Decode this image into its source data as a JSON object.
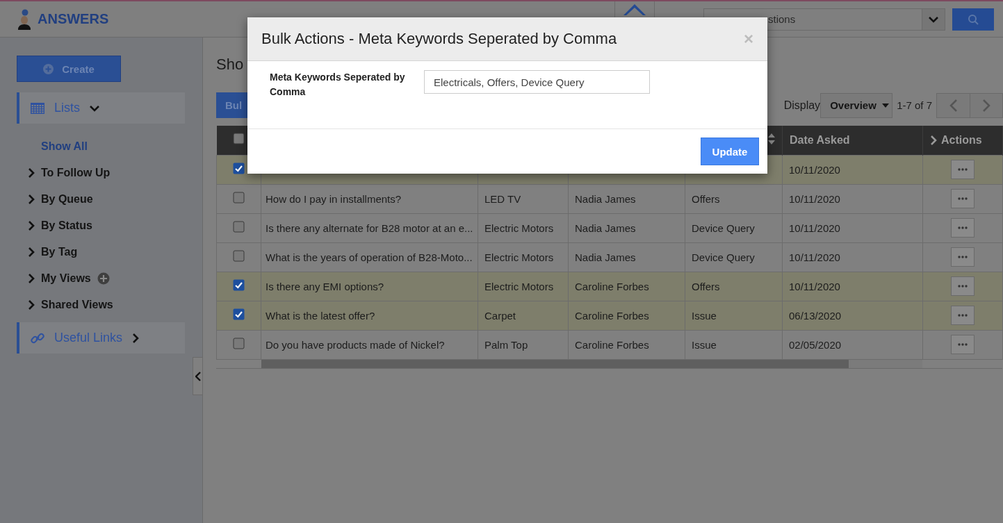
{
  "header": {
    "logo": "ANSWERS",
    "search": {
      "placeholder": "stions"
    }
  },
  "sidebar": {
    "create_button": "Create",
    "lists": {
      "label": "Lists",
      "expanded": true,
      "items": [
        {
          "label": "Show All",
          "kind": "link"
        },
        {
          "label": "To Follow Up",
          "kind": "group"
        },
        {
          "label": "By Queue",
          "kind": "group"
        },
        {
          "label": "By Status",
          "kind": "group"
        },
        {
          "label": "By Tag",
          "kind": "group"
        },
        {
          "label": "My Views",
          "kind": "addable"
        },
        {
          "label": "Shared Views",
          "kind": "group"
        }
      ]
    },
    "useful_links": {
      "label": "Useful Links",
      "expanded": false
    }
  },
  "main": {
    "title": "Sho",
    "bulk_button": "Bul",
    "display_label": "Display",
    "display_value": "Overview",
    "pagination": "1-7 of 7"
  },
  "table": {
    "header_checked": false,
    "date_header": "Date Asked",
    "actions_header": "Actions",
    "rows": [
      {
        "selected": true,
        "date": "10/11/2020"
      },
      {
        "selected": false,
        "question": "How do I pay in installments?",
        "product": "LED TV",
        "asked_by": "Nadia James",
        "category": "Offers",
        "date": "10/11/2020"
      },
      {
        "selected": false,
        "question": "Is there any alternate for B28 motor at an e...",
        "product": "Electric Motors",
        "asked_by": "Nadia James",
        "category": "Device Query",
        "date": "10/11/2020"
      },
      {
        "selected": false,
        "question": "What is the years of operation of B28-Moto...",
        "product": "Electric Motors",
        "asked_by": "Nadia James",
        "category": "Device Query",
        "date": "10/11/2020"
      },
      {
        "selected": true,
        "question": "Is there any EMI options?",
        "product": "Electric Motors",
        "asked_by": "Caroline Forbes",
        "category": "Offers",
        "date": "10/11/2020"
      },
      {
        "selected": true,
        "question": "What is the latest offer?",
        "product": "Carpet",
        "asked_by": "Caroline Forbes",
        "category": "Issue",
        "date": "06/13/2020"
      },
      {
        "selected": false,
        "question": "Do you have products made of Nickel?",
        "product": "Palm Top",
        "asked_by": "Caroline Forbes",
        "category": "Issue",
        "date": "02/05/2020"
      }
    ]
  },
  "modal": {
    "title": "Bulk Actions - Meta Keywords Seperated by Comma",
    "close": "×",
    "field_label": "Meta Keywords Seperated by Comma",
    "field_value": "Electricals, Offers, Device Query",
    "button": "Update"
  }
}
